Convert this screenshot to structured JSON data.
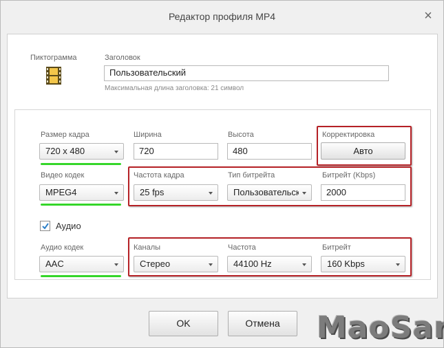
{
  "window": {
    "title": "Редактор профиля MP4"
  },
  "header": {
    "icon_label": "Пиктограмма",
    "icon_name": "film-strip-icon",
    "title_label": "Заголовок",
    "title_value": "Пользовательский",
    "title_hint": "Максимальная длина заголовка: 21 символ"
  },
  "video": {
    "frame_size_label": "Размер кадра",
    "frame_size_value": "720 x 480",
    "width_label": "Ширина",
    "width_value": "720",
    "height_label": "Высота",
    "height_value": "480",
    "correction_label": "Корректировка",
    "correction_button": "Авто",
    "codec_label": "Видео кодек",
    "codec_value": "MPEG4",
    "fps_label": "Частота кадра",
    "fps_value": "25 fps",
    "bitrate_type_label": "Тип битрейта",
    "bitrate_type_value": "Пользовательский",
    "bitrate_label": "Битрейт (Kbps)",
    "bitrate_value": "2000"
  },
  "audio": {
    "enabled_label": "Аудио",
    "enabled": true,
    "codec_label": "Аудио кодек",
    "codec_value": "AAC",
    "channels_label": "Каналы",
    "channels_value": "Стерео",
    "frequency_label": "Частота",
    "frequency_value": "44100 Hz",
    "bitrate_label": "Битрейт",
    "bitrate_value": "160 Kbps"
  },
  "footer": {
    "ok_label": "OK",
    "cancel_label": "Отмена"
  },
  "watermark": "MaoSan",
  "colors": {
    "highlight_red": "#b52025",
    "highlight_green": "#34d629"
  }
}
